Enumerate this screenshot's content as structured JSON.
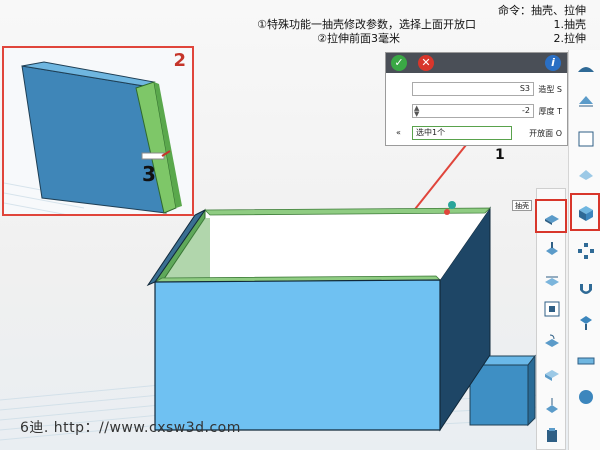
{
  "instructions": {
    "line1": "命令：抽壳、拉伸",
    "line2": "1.抽壳",
    "line3": "2.拉伸",
    "note1": "①特殊功能一抽壳修改参数，选择上面开放口",
    "note2": "②拉伸前面3毫米"
  },
  "inset": {
    "label_number": "2",
    "callout_number": "3"
  },
  "property_panel": {
    "ok_icon": "check-icon",
    "cancel_icon": "close-icon",
    "info_label": "i",
    "rows": [
      {
        "label": "造型 S",
        "value": "S3"
      },
      {
        "label": "厚度 T",
        "value": "-2"
      },
      {
        "label": "开放面 O",
        "value": "选中1个"
      }
    ],
    "callout_number": "1"
  },
  "toolbar_mid": {
    "tooltip": "抽壳"
  },
  "watermark": "6迪. http：//www.cxsw3d.com",
  "colors": {
    "part_blue": "#6fc1f2",
    "part_blue_dark": "#3c7fa8",
    "accent_red": "#d8362b",
    "accent_green": "#3aa845"
  }
}
